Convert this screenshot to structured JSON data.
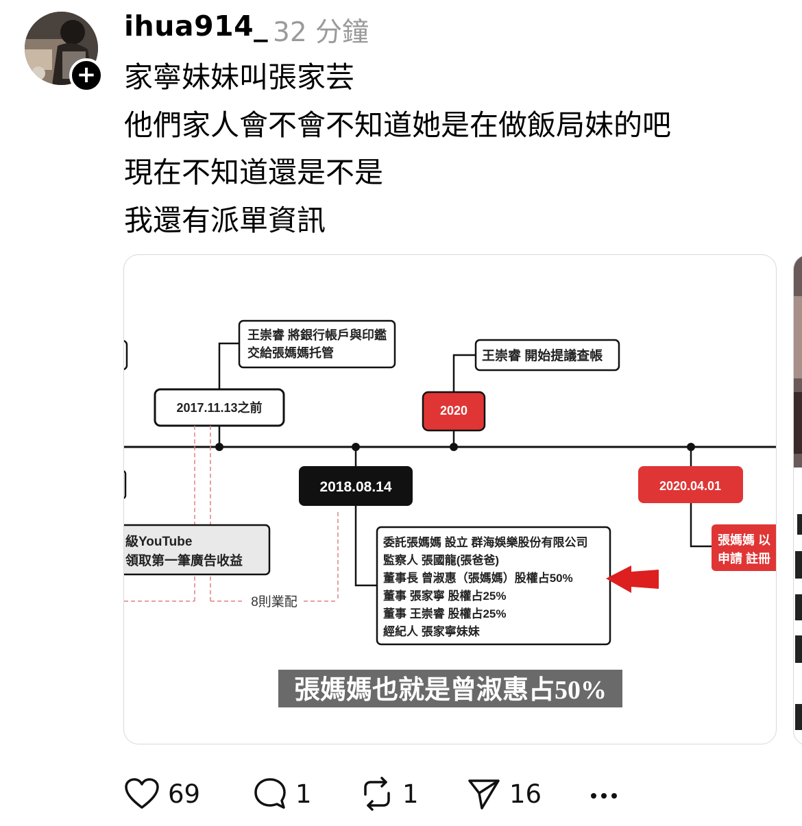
{
  "post": {
    "username": "ihua914_",
    "timestamp": "32 分鐘",
    "lines": [
      "家寧妹妹叫張家芸",
      "他們家人會不會不知道她是在做飯局妹的吧",
      "現在不知道還是不是",
      "我還有派單資訊"
    ]
  },
  "image": {
    "note_top_line1": "王崇睿 將銀行帳戶與印鑑",
    "note_top_line2": "交給張媽媽托管",
    "date_1": "2017.11.13之前",
    "note_2020": "王崇睿 開始提議查帳",
    "date_2020": "2020",
    "date_2018": "2018.08.14",
    "date_20200401": "2020.04.01",
    "left_box_line1": "級YouTube",
    "left_box_line2": "領取第一筆廣告收益",
    "label_8": "8則業配",
    "company_lines": [
      "委託張媽媽 設立 群海娛樂股份有限公司",
      "監察人 張國龍(張爸爸)",
      "董事長 曾淑惠（張媽媽）股權占50%",
      "董事 張家寧 股權占25%",
      "董事 王崇睿 股權占25%",
      "經紀人 張家寧妹妹"
    ],
    "right_red_line1": "張媽媽 以",
    "right_red_line2": "申請 註冊",
    "caption": "張媽媽也就是曾淑惠占50%"
  },
  "actions": {
    "likes": "69",
    "replies": "1",
    "reposts": "1",
    "shares": "16"
  },
  "icons": {
    "like": "heart-icon",
    "reply": "comment-icon",
    "repost": "repost-icon",
    "share": "send-icon",
    "more": "more-icon",
    "follow": "plus-icon"
  },
  "colors": {
    "accent_red": "#e03535",
    "timestamp_gray": "#9a9a9a"
  }
}
